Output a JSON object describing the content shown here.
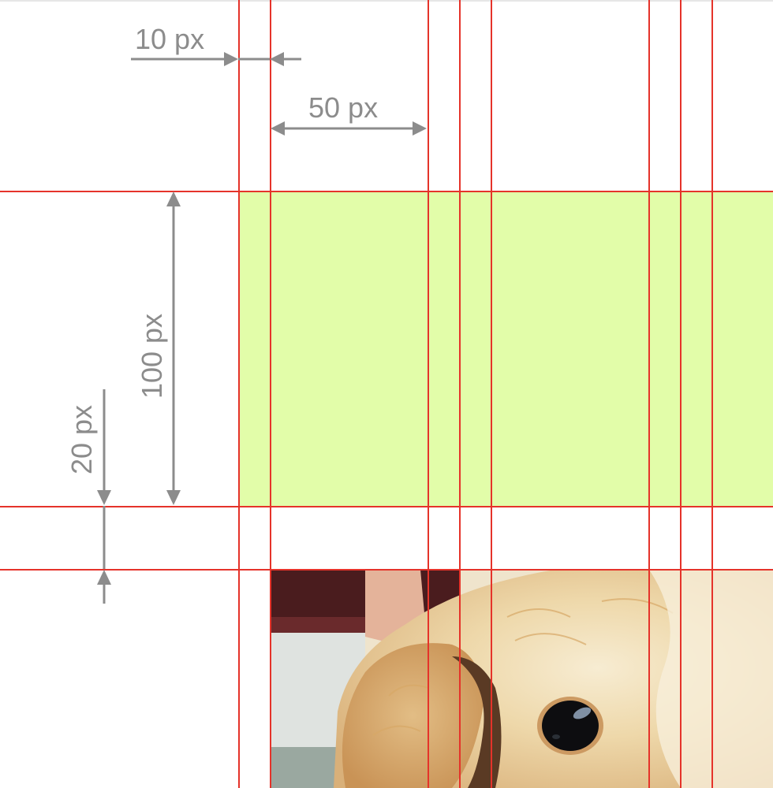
{
  "dimensions": {
    "gap_left_label": "10 px",
    "column_width_label": "50 px",
    "row_height_label": "100 px",
    "row_gap_label": "20 px"
  },
  "colors": {
    "guide_line": "#e5332a",
    "annotation": "#8c8c8c",
    "highlight_band": "#e2fda9",
    "background": "#ffffff"
  },
  "photo": {
    "subject": "puppy-face"
  }
}
